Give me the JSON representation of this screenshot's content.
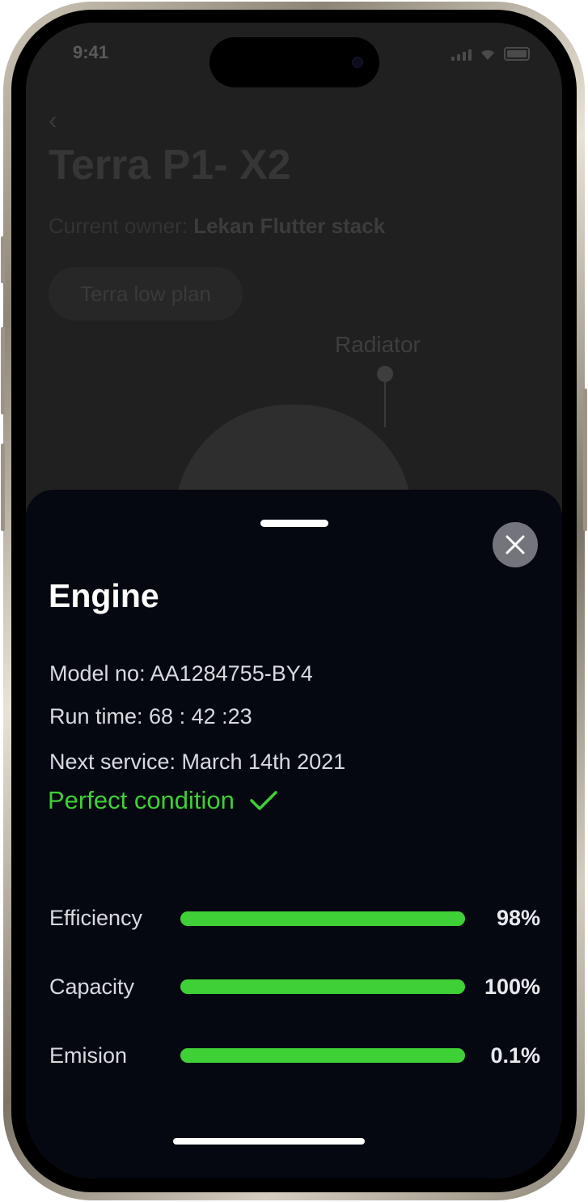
{
  "background": {
    "time": "9:41",
    "title": "Terra P1- X2",
    "owner_label": "Current owner:",
    "owner_name": "Lekan Flutter stack",
    "plan": "Terra low plan",
    "radiator_label": "Radiator"
  },
  "sheet": {
    "title": "Engine",
    "model": "Model no: AA1284755-BY4",
    "run_time": "Run time: 68 : 42 :23",
    "next_service": "Next service: March 14th 2021",
    "condition": "Perfect condition",
    "metrics": [
      {
        "label": "Efficiency",
        "value": "98%"
      },
      {
        "label": "Capacity",
        "value": "100%"
      },
      {
        "label": "Emision",
        "value": "0.1%"
      }
    ]
  },
  "icons": {
    "close": "close-icon",
    "check": "checkmark-icon",
    "back": "chevron-left-icon"
  },
  "colors": {
    "accent_green": "#3fcf37",
    "sheet_bg": "#050811",
    "close_bg": "#74757c"
  }
}
